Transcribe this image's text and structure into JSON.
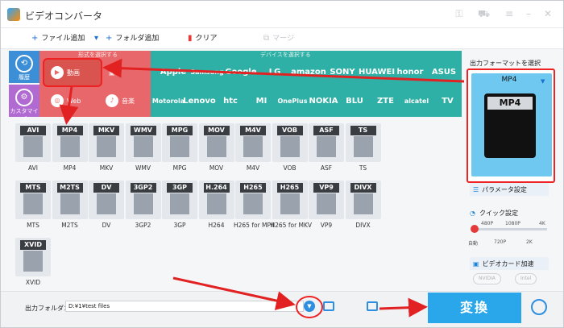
{
  "app": {
    "title": "ビデオコンバータ"
  },
  "toolbar": {
    "add_file": "ファイル追加",
    "add_folder": "フォルダ追加",
    "clear": "クリア",
    "merge": "マージ"
  },
  "left_categories": [
    {
      "label": "履歴",
      "icon": "history-icon"
    },
    {
      "label": "カスタマイズ",
      "icon": "customize-icon"
    }
  ],
  "format_section_label": "形式を選択する",
  "device_section_label": "デバイスを選択する",
  "format_tabs": [
    {
      "label": "動画",
      "icon": "play-icon",
      "selected": true
    },
    {
      "label": "Web",
      "icon": "globe-icon"
    },
    {
      "label": "音楽",
      "icon": "audio-icon"
    }
  ],
  "brands_row1": [
    "Apple",
    "Samsung",
    "Google",
    "LG",
    "amazon",
    "SONY",
    "HUAWEI",
    "honor",
    "ASUS"
  ],
  "brands_row2": [
    "Motorola",
    "Lenovo",
    "htc",
    "MI",
    "OnePlus",
    "NOKIA",
    "BLU",
    "ZTE",
    "alcatel",
    "TV"
  ],
  "formats": [
    {
      "name": "AVI",
      "tag": "AVI"
    },
    {
      "name": "MP4",
      "tag": "MP4"
    },
    {
      "name": "MKV",
      "tag": "MKV"
    },
    {
      "name": "WMV",
      "tag": "WMV"
    },
    {
      "name": "MPG",
      "tag": "MPG"
    },
    {
      "name": "MOV",
      "tag": "MOV"
    },
    {
      "name": "M4V",
      "tag": "M4V"
    },
    {
      "name": "VOB",
      "tag": "VOB"
    },
    {
      "name": "ASF",
      "tag": "ASF"
    },
    {
      "name": "TS",
      "tag": "TS"
    },
    {
      "name": "MTS",
      "tag": "MTS"
    },
    {
      "name": "M2TS",
      "tag": "M2TS"
    },
    {
      "name": "DV",
      "tag": "DV"
    },
    {
      "name": "3GP2",
      "tag": "3GP2"
    },
    {
      "name": "3GP",
      "tag": "3GP"
    },
    {
      "name": "H264",
      "tag": "H.264"
    },
    {
      "name": "H265 for MP4",
      "tag": "H265"
    },
    {
      "name": "H265 for MKV",
      "tag": "H265"
    },
    {
      "name": "VP9",
      "tag": "VP9"
    },
    {
      "name": "DIVX",
      "tag": "DIVX"
    },
    {
      "name": "XVID",
      "tag": "XVID"
    }
  ],
  "right_panel": {
    "output_format_label": "出力フォーマットを選択",
    "selected_format": "MP4",
    "selected_icon_tag": "MP4",
    "param_settings": "パラメータ設定",
    "quick_settings": "クイック設定",
    "quality_ticks_top": [
      "480P",
      "1080P",
      "4K"
    ],
    "quality_ticks_bottom": [
      "自動",
      "720P",
      "2K"
    ],
    "quality_level": 0.0,
    "gpu_accel": "ビデオカード加速",
    "gpu_chips": [
      "NVIDIA",
      "Intel"
    ]
  },
  "bottom": {
    "output_folder_label": "出力フォルダ：",
    "output_path": "D:¥1¥test files",
    "convert_label": "変換"
  },
  "colors": {
    "accent_blue": "#2aa7ea",
    "annotation_red": "#e22222",
    "video_tab_red": "#e8676a",
    "device_teal": "#2fb0a6"
  }
}
